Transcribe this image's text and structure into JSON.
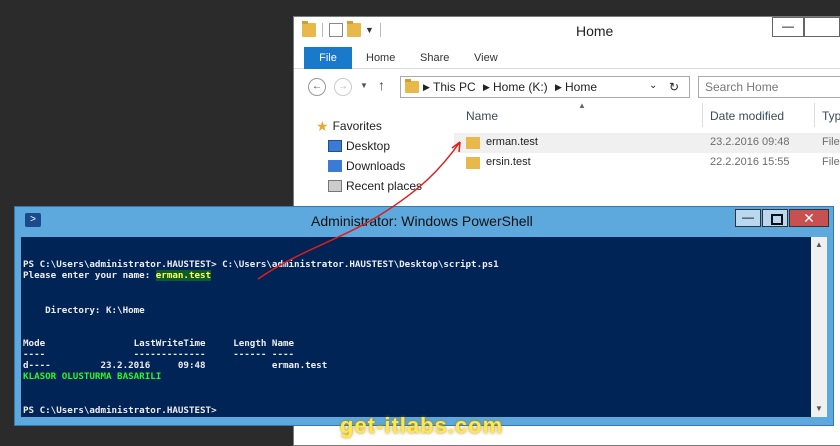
{
  "explorer": {
    "title": "Home",
    "ribbon_tabs": [
      "File",
      "Home",
      "Share",
      "View"
    ],
    "address": {
      "segments": [
        "This PC",
        "Home (K:)",
        "Home"
      ]
    },
    "search_placeholder": "Search Home",
    "nav": [
      "Favorites",
      "Desktop",
      "Downloads",
      "Recent places"
    ],
    "columns": {
      "name": "Name",
      "date": "Date modified",
      "type": "Typ"
    },
    "files": [
      {
        "name": "erman.test",
        "date": "23.2.2016 09:48",
        "type": "File"
      },
      {
        "name": "ersin.test",
        "date": "22.2.2016 15:55",
        "type": "File"
      }
    ]
  },
  "powershell": {
    "title": "Administrator: Windows PowerShell",
    "lines": {
      "prompt1": "PS C:\\Users\\administrator.HAUSTEST> C:\\Users\\administrator.HAUSTEST\\Desktop\\script.ps1",
      "enter_prefix": "Please enter your name: ",
      "entered_name": "erman.test",
      "directory": "    Directory: K:\\Home",
      "header": "Mode                LastWriteTime     Length Name",
      "dashes": "----                -------------     ------ ----",
      "row": "d----         23.2.2016     09:48            erman.test",
      "success": "KLASOR OLUSTURMA BASARILI",
      "prompt2": "PS C:\\Users\\administrator.HAUSTEST>"
    }
  },
  "watermark": "get-itlabs.com",
  "colors": {
    "console_bg": "#012456",
    "accent_blue": "#1979ca",
    "arrow": "#e01b1b"
  }
}
